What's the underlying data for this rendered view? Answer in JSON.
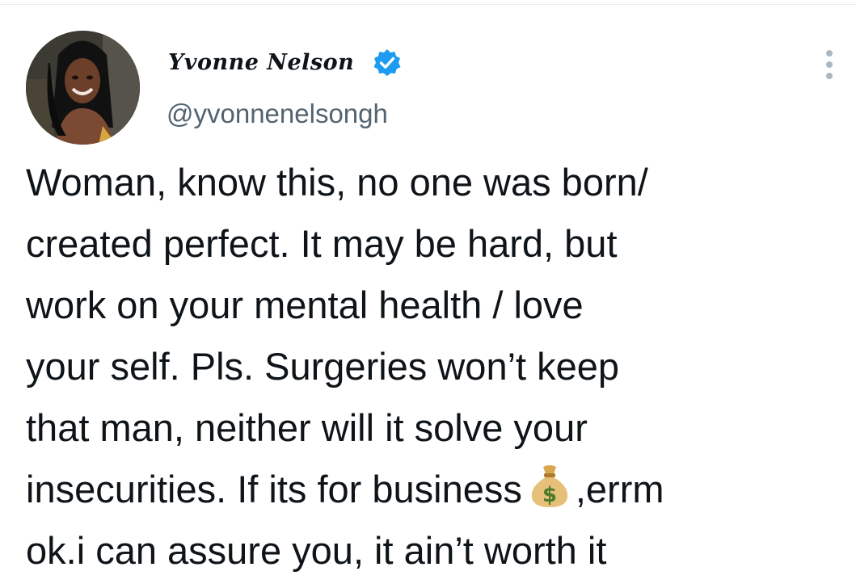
{
  "tweet": {
    "author": {
      "display_name": "Yvonne Nelson",
      "handle": "@yvonnenelsongh",
      "verified": true,
      "avatar_icon": "profile-photo"
    },
    "lines": [
      "Woman, know this, no one was born/",
      "created perfect. It may be hard, but",
      "work on your mental health / love",
      "your self. Pls. Surgeries won’t keep",
      "that man, neither will it solve your"
    ],
    "line6_before_emoji": "insecurities. If its for business",
    "line6_emoji_icon": "money-bag-icon",
    "line6_after_emoji": ",errm",
    "line7": "ok.i can assure you, it ain’t worth it"
  },
  "colors": {
    "text_primary": "#0f1419",
    "text_secondary": "#536471",
    "verified_blue": "#1d9bf0",
    "divider": "#e6ecf0"
  }
}
